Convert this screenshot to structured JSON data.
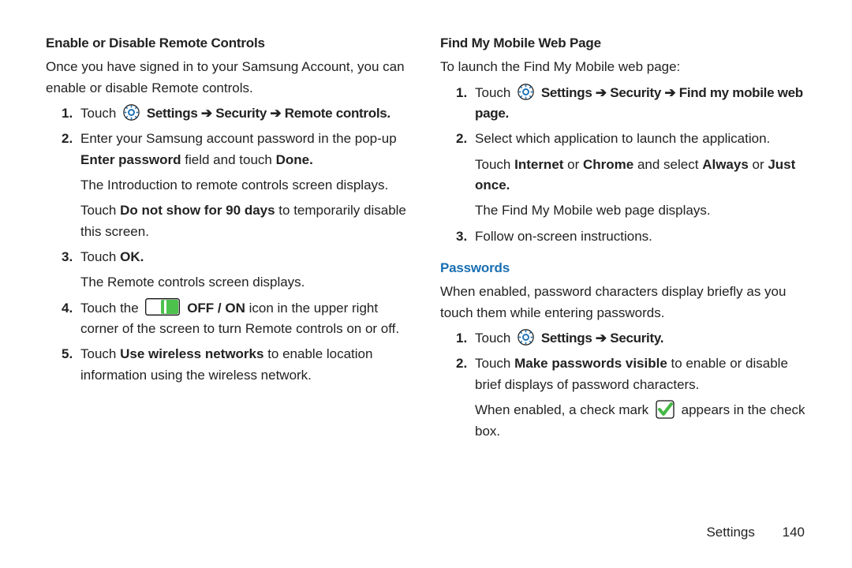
{
  "left": {
    "heading": "Enable or Disable Remote Controls",
    "intro": "Once you have signed in to your Samsung Account, you can enable or disable Remote controls.",
    "step1_a": "Touch ",
    "step1_b": " Settings ➔ Security ➔ Remote controls.",
    "step2_a": "Enter your Samsung account password in the pop-up ",
    "step2_b": "Enter password",
    "step2_c": " field and touch ",
    "step2_d": "Done.",
    "step2_sub1": "The Introduction to remote controls screen displays.",
    "step2_sub2_a": "Touch ",
    "step2_sub2_b": "Do not show for 90 days",
    "step2_sub2_c": " to temporarily disable this screen.",
    "step3_a": "Touch ",
    "step3_b": "OK.",
    "step3_sub": "The Remote controls screen displays.",
    "step4_a": "Touch the ",
    "step4_b": " OFF / ON",
    "step4_c": " icon in the upper right corner of the screen to turn Remote controls on or off.",
    "step5_a": "Touch ",
    "step5_b": "Use wireless networks",
    "step5_c": " to enable location information using the wireless network."
  },
  "right": {
    "heading": "Find My Mobile Web Page",
    "intro": "To launch the Find My Mobile web page:",
    "step1_a": "Touch ",
    "step1_b": " Settings ➔ Security ➔ Find my mobile web page.",
    "step2_a": "Select which application to launch the application.",
    "step2_sub_a": "Touch ",
    "step2_sub_b": "Internet",
    "step2_sub_c": " or ",
    "step2_sub_d": "Chrome",
    "step2_sub_e": " and select ",
    "step2_sub_f": "Always",
    "step2_sub_g": " or ",
    "step2_sub_h": "Just once.",
    "step2_sub2": "The Find My Mobile web page displays.",
    "step3": "Follow on-screen instructions.",
    "pwHeading": "Passwords",
    "pwIntro": "When enabled, password characters display briefly as you touch them while entering passwords.",
    "pw1_a": "Touch ",
    "pw1_b": " Settings ➔ Security.",
    "pw2_a": "Touch ",
    "pw2_b": "Make passwords visible",
    "pw2_c": " to enable or disable brief displays of password characters.",
    "pw2_sub_a": "When enabled, a check mark ",
    "pw2_sub_b": " appears in the check box."
  },
  "footer": {
    "section": "Settings",
    "page": "140"
  }
}
